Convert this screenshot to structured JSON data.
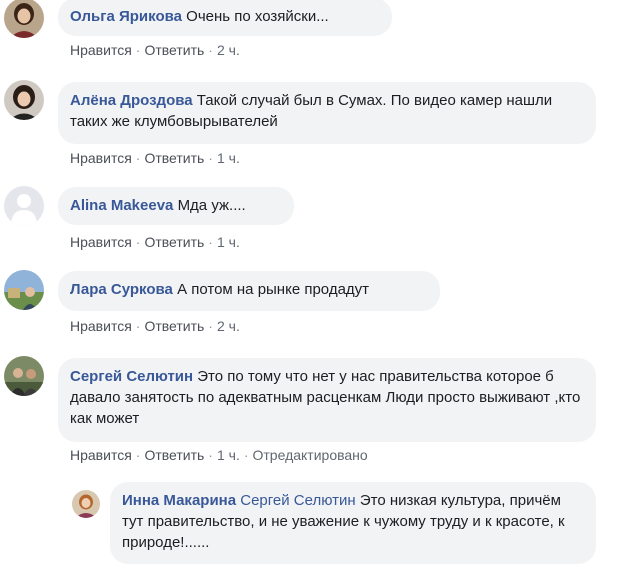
{
  "actions": {
    "like": "Нравится",
    "reply": "Ответить",
    "dot": "·"
  },
  "comments": [
    {
      "author": "Ольга Ярикова",
      "text": "Очень по хозяйски...",
      "time": "2 ч."
    },
    {
      "author": "Алёна Дроздова",
      "text": "Такой случай был в Сумах. По видео камер нашли таких же клумбовырывателей",
      "time": "1 ч."
    },
    {
      "author": "Alina Makeeva",
      "text": "Мда уж....",
      "time": "1 ч."
    },
    {
      "author": "Лара Суркова",
      "text": "А потом на рынке продадут",
      "time": "2 ч."
    },
    {
      "author": "Сергей Селютин",
      "text": "Это по тому что нет у нас правительства которое б давало занятость по адекватным расценкам Люди просто выживают ,кто как может",
      "time": "1 ч.",
      "edited": "Отредактировано"
    }
  ],
  "reply": {
    "author": "Инна Макарина",
    "mention": "Сергей Селютин",
    "text": "Это низкая культура, причём тут правительство, и не уважение к чужому труду и к красоте, к природе!......"
  },
  "colors": {
    "link": "#385898",
    "bubble": "#f2f3f5",
    "meta": "#606770"
  }
}
